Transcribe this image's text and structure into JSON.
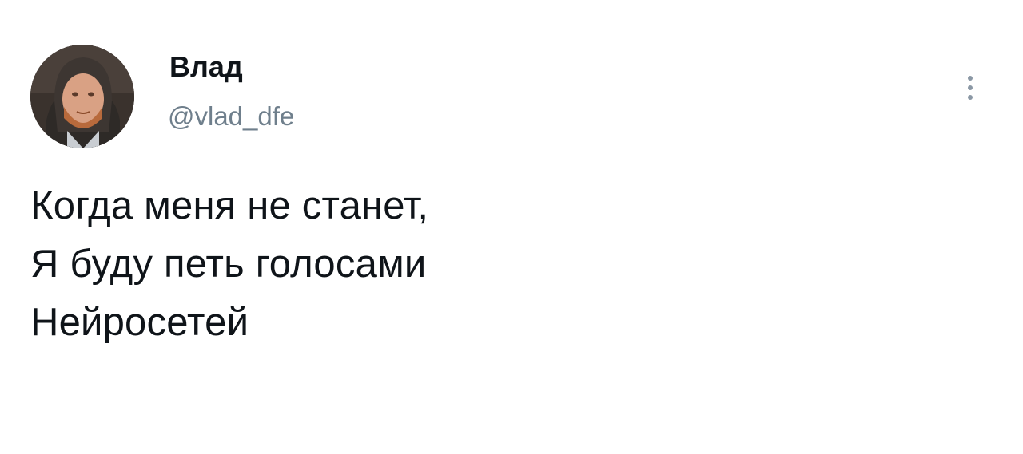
{
  "tweet": {
    "author": {
      "display_name": "Влад",
      "handle": "@vlad_dfe",
      "avatar_icon": "user-avatar-photo"
    },
    "more_icon": "more-vertical-icon",
    "text_lines": [
      "Когда меня не станет,",
      "Я буду петь голосами",
      "Нейросетей"
    ]
  },
  "colors": {
    "text": "#0f1419",
    "secondary_text": "#6f7f8c",
    "background": "#ffffff"
  }
}
